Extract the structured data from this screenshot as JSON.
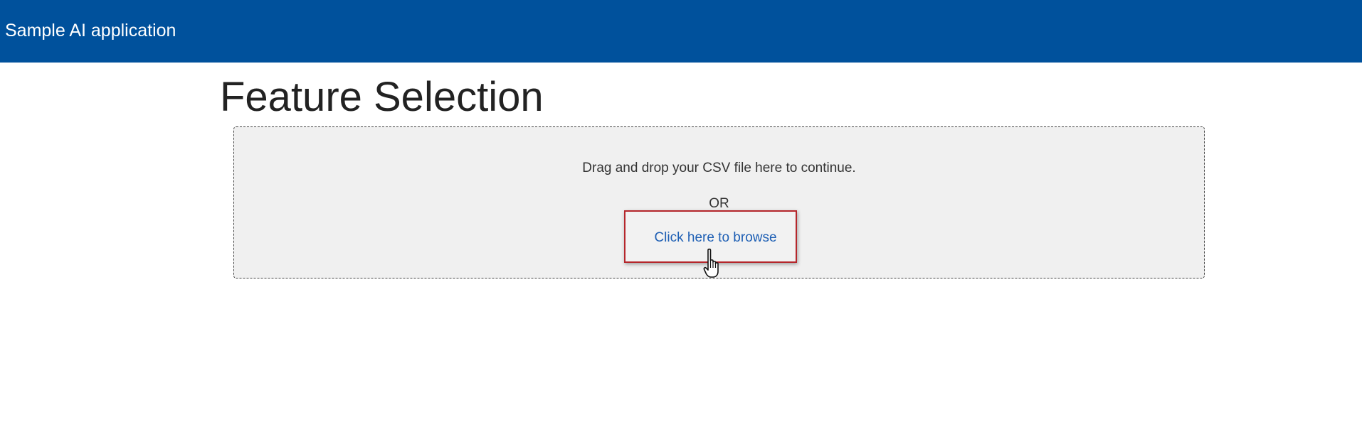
{
  "header": {
    "app_title": "Sample AI application",
    "background_color": "#00519c"
  },
  "main": {
    "page_title": "Feature Selection",
    "upload": {
      "instruction": "Drag and drop your CSV file here to continue.",
      "separator": "OR",
      "browse_label": "Click here to browse",
      "link_color": "#1e5fb4",
      "highlight_color": "#b5262b"
    }
  },
  "overlay": {
    "cursor_icon": "hand-pointer-icon"
  }
}
